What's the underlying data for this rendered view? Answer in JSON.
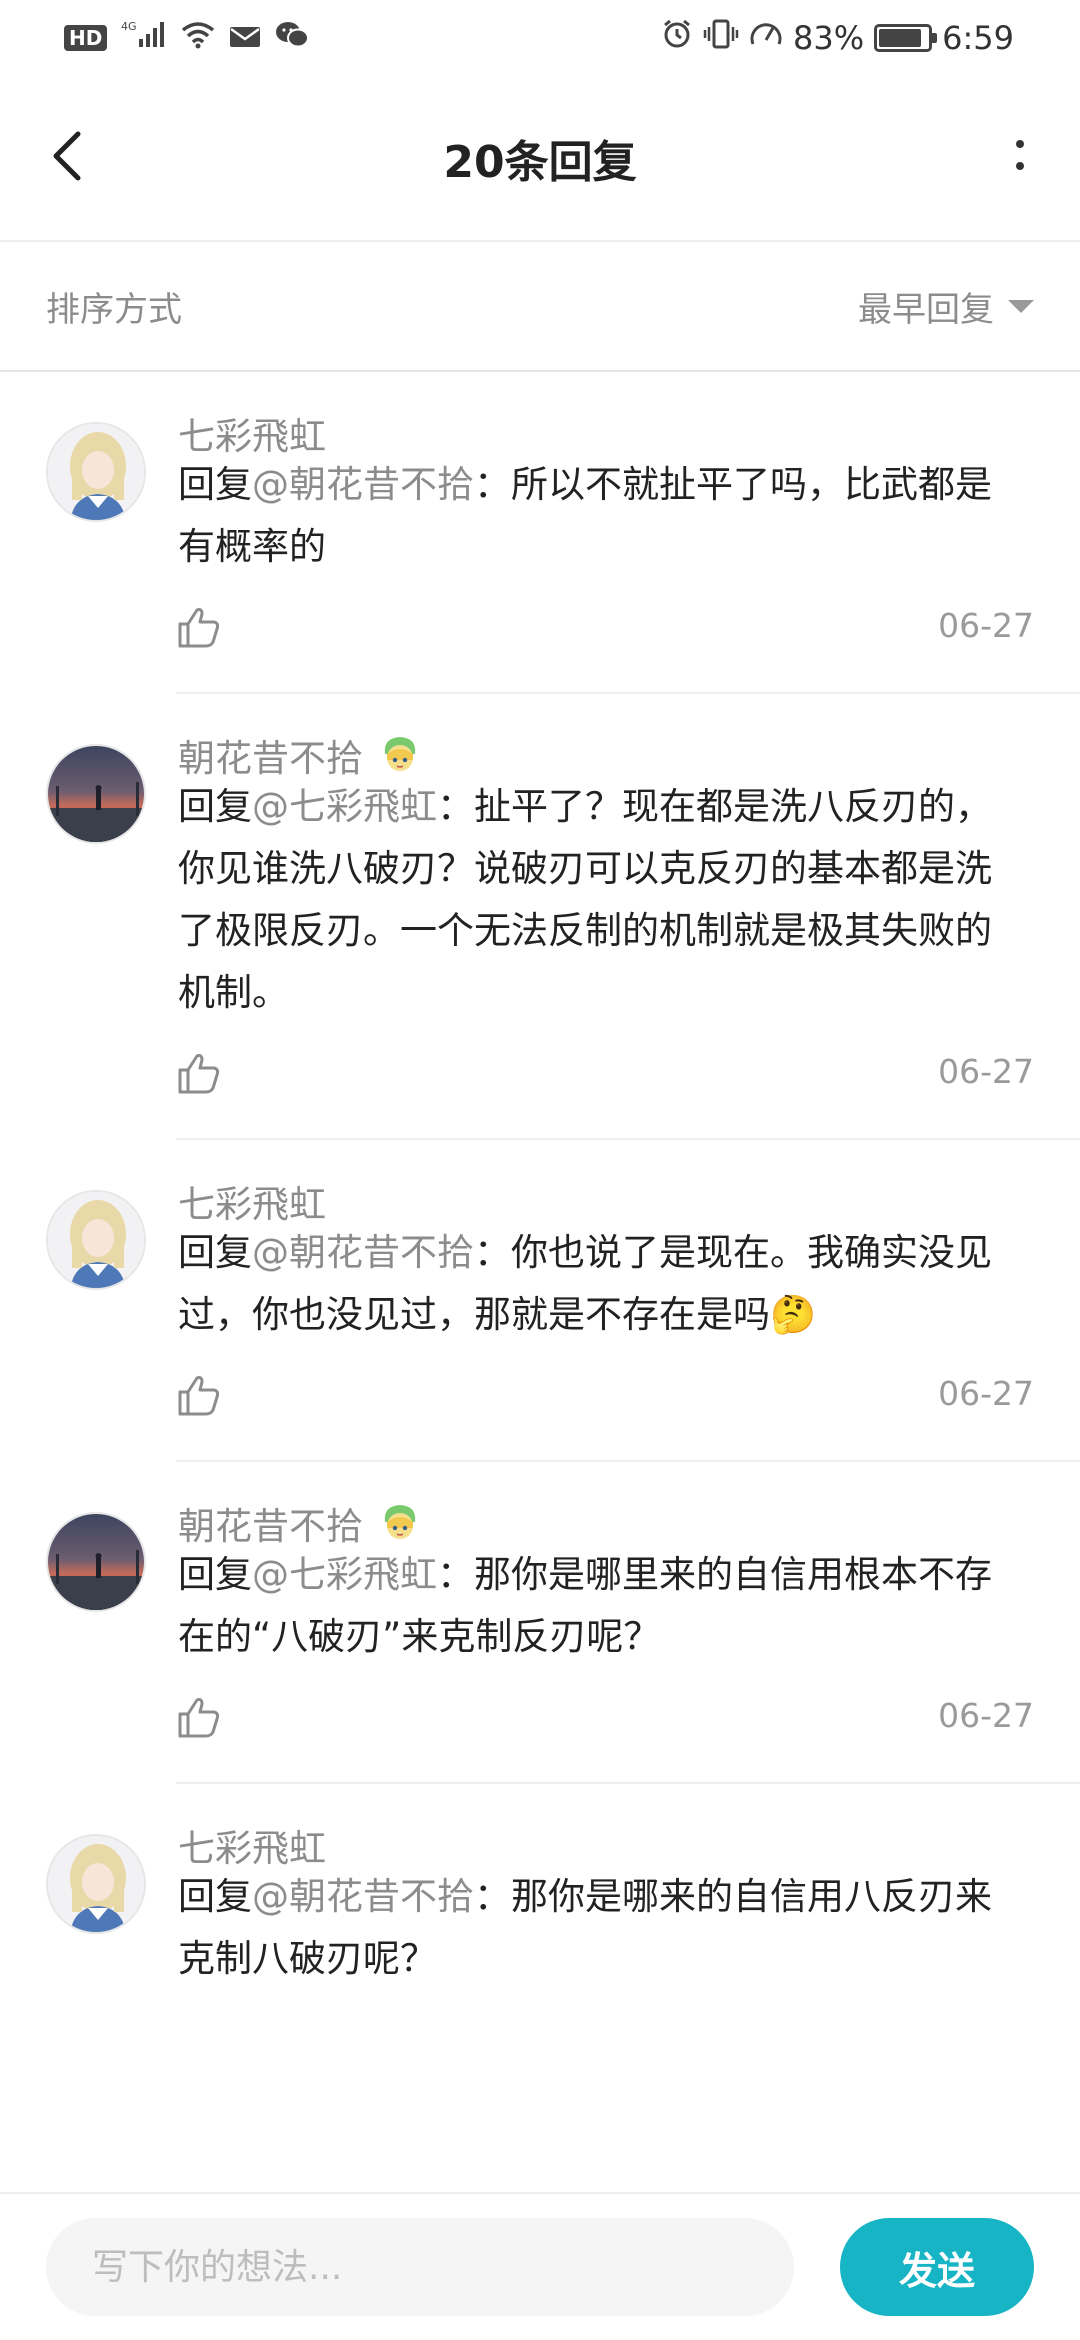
{
  "status_bar": {
    "hd": "HD",
    "network": "4G",
    "battery": "83%",
    "battery_level": 0.83,
    "time": "6:59",
    "icons": [
      "signal-icon",
      "wifi-icon",
      "mail-icon",
      "wechat-icon",
      "alarm-icon",
      "vibrate-icon",
      "speed-icon",
      "battery-icon"
    ]
  },
  "header": {
    "title": "20条回复",
    "back_icon": "chevron-left-icon",
    "more_icon": "more-vertical-icon"
  },
  "sort": {
    "label": "排序方式",
    "selected": "最早回复"
  },
  "replies": [
    {
      "user": "七彩飛虹",
      "has_badge": false,
      "prefix": "回复",
      "mention": "@朝花昔不拾",
      "sep": "：",
      "text": "所以不就扯平了吗，比武都是有概率的",
      "date": "06-27"
    },
    {
      "user": "朝花昔不拾",
      "has_badge": true,
      "prefix": "回复",
      "mention": "@七彩飛虹",
      "sep": "：",
      "text": "扯平了？现在都是洗八反刃的，你见谁洗八破刃？说破刃可以克反刃的基本都是洗了极限反刃。一个无法反制的机制就是极其失败的机制。",
      "date": "06-27"
    },
    {
      "user": "七彩飛虹",
      "has_badge": false,
      "prefix": "回复",
      "mention": "@朝花昔不拾",
      "sep": "：",
      "text": "你也说了是现在。我确实没见过，你也没见过，那就是不存在是吗🤔",
      "date": "06-27"
    },
    {
      "user": "朝花昔不拾",
      "has_badge": true,
      "prefix": "回复",
      "mention": "@七彩飛虹",
      "sep": "：",
      "text": "那你是哪里来的自信用根本不存在的“八破刃”来克制反刃呢？",
      "date": "06-27"
    },
    {
      "user": "七彩飛虹",
      "has_badge": false,
      "prefix": "回复",
      "mention": "@朝花昔不拾",
      "sep": "：",
      "text": "那你是哪来的自信用八反刃来克制八破刃呢？",
      "date": ""
    }
  ],
  "composer": {
    "placeholder": "写下你的想法...",
    "send": "发送"
  },
  "colors": {
    "accent": "#17b4c6",
    "muted_text": "#8c8c8c",
    "divider": "#eeeeee"
  }
}
